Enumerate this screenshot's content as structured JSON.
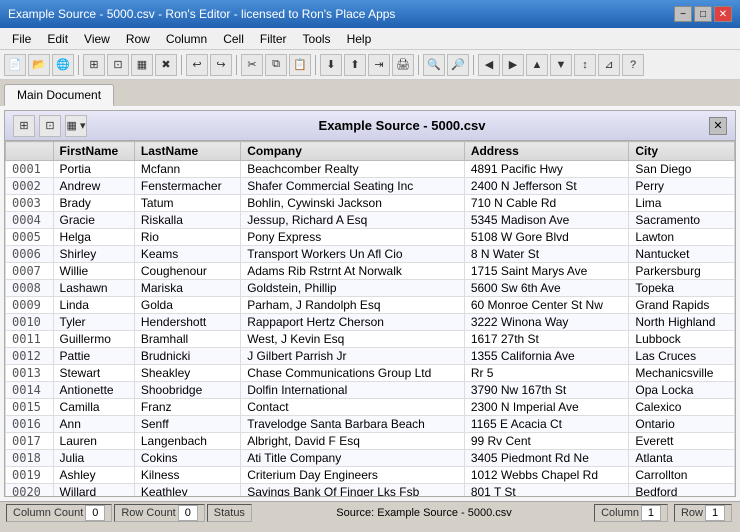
{
  "titleBar": {
    "title": "Example Source - 5000.csv - Ron's Editor - licensed to Ron's Place Apps",
    "minimizeLabel": "−",
    "maximizeLabel": "□",
    "closeLabel": "✕"
  },
  "menuBar": {
    "items": [
      "File",
      "Edit",
      "View",
      "Row",
      "Column",
      "Cell",
      "Filter",
      "Tools",
      "Help"
    ]
  },
  "tabs": [
    {
      "label": "Main Document",
      "active": true
    }
  ],
  "innerPanel": {
    "title": "Example Source - 5000.csv",
    "icons": [
      "⊞",
      "⊡",
      "▦"
    ]
  },
  "table": {
    "columns": [
      "",
      "FirstName",
      "LastName",
      "Company",
      "Address",
      "City"
    ],
    "rows": [
      [
        "0001",
        "Portia",
        "Mcfann",
        "Beachcomber Realty",
        "4891 Pacific Hwy",
        "San Diego"
      ],
      [
        "0002",
        "Andrew",
        "Fenstermacher",
        "Shafer Commercial Seating Inc",
        "2400 N Jefferson St",
        "Perry"
      ],
      [
        "0003",
        "Brady",
        "Tatum",
        "Bohlin, Cywinski Jackson",
        "710 N Cable Rd",
        "Lima"
      ],
      [
        "0004",
        "Gracie",
        "Riskalla",
        "Jessup, Richard A Esq",
        "5345 Madison Ave",
        "Sacramento"
      ],
      [
        "0005",
        "Helga",
        "Rio",
        "Pony Express",
        "5108 W Gore Blvd",
        "Lawton"
      ],
      [
        "0006",
        "Shirley",
        "Keams",
        "Transport Workers Un Afl Cio",
        "8 N Water St",
        "Nantucket"
      ],
      [
        "0007",
        "Willie",
        "Coughenour",
        "Adams Rib Rstrnt At Norwalk",
        "1715 Saint Marys Ave",
        "Parkersburg"
      ],
      [
        "0008",
        "Lashawn",
        "Mariska",
        "Goldstein, Phillip",
        "5600 Sw 6th Ave",
        "Topeka"
      ],
      [
        "0009",
        "Linda",
        "Golda",
        "Parham, J Randolph Esq",
        "60 Monroe Center St Nw",
        "Grand Rapids"
      ],
      [
        "0010",
        "Tyler",
        "Hendershott",
        "Rappaport Hertz Cherson",
        "3222 Winona Way",
        "North Highland"
      ],
      [
        "0011",
        "Guillermo",
        "Bramhall",
        "West, J Kevin Esq",
        "1617 27th St",
        "Lubbock"
      ],
      [
        "0012",
        "Pattie",
        "Brudnicki",
        "J Gilbert Parrish Jr",
        "1355 California Ave",
        "Las Cruces"
      ],
      [
        "0013",
        "Stewart",
        "Sheakley",
        "Chase Communications Group Ltd",
        "Rr 5",
        "Mechanicsville"
      ],
      [
        "0014",
        "Antionette",
        "Shoobridge",
        "Dolfin International",
        "3790 Nw 167th St",
        "Opa Locka"
      ],
      [
        "0015",
        "Camilla",
        "Franz",
        "Contact",
        "2300 N Imperial Ave",
        "Calexico"
      ],
      [
        "0016",
        "Ann",
        "Senff",
        "Travelodge Santa Barbara Beach",
        "1165 E Acacia Ct",
        "Ontario"
      ],
      [
        "0017",
        "Lauren",
        "Langenbach",
        "Albright, David F Esq",
        "99 Rv Cent",
        "Everett"
      ],
      [
        "0018",
        "Julia",
        "Cokins",
        "Ati Title Company",
        "3405 Piedmont Rd Ne",
        "Atlanta"
      ],
      [
        "0019",
        "Ashley",
        "Kilness",
        "Criterium Day Engineers",
        "1012 Webbs Chapel Rd",
        "Carrollton"
      ],
      [
        "0020",
        "Willard",
        "Keathley",
        "Savings Bank Of Finger Lks Fsb",
        "801 T St",
        "Bedford"
      ]
    ]
  },
  "statusBar": {
    "columnCountLabel": "Column Count",
    "columnCountValue": "0",
    "rowCountLabel": "Row Count",
    "rowCountValue": "0",
    "statusLabel": "Status",
    "sourceText": "Source: Example Source - 5000.csv",
    "columnLabel": "Column",
    "columnValue": "1",
    "rowLabel": "Row",
    "rowValue": "1"
  }
}
